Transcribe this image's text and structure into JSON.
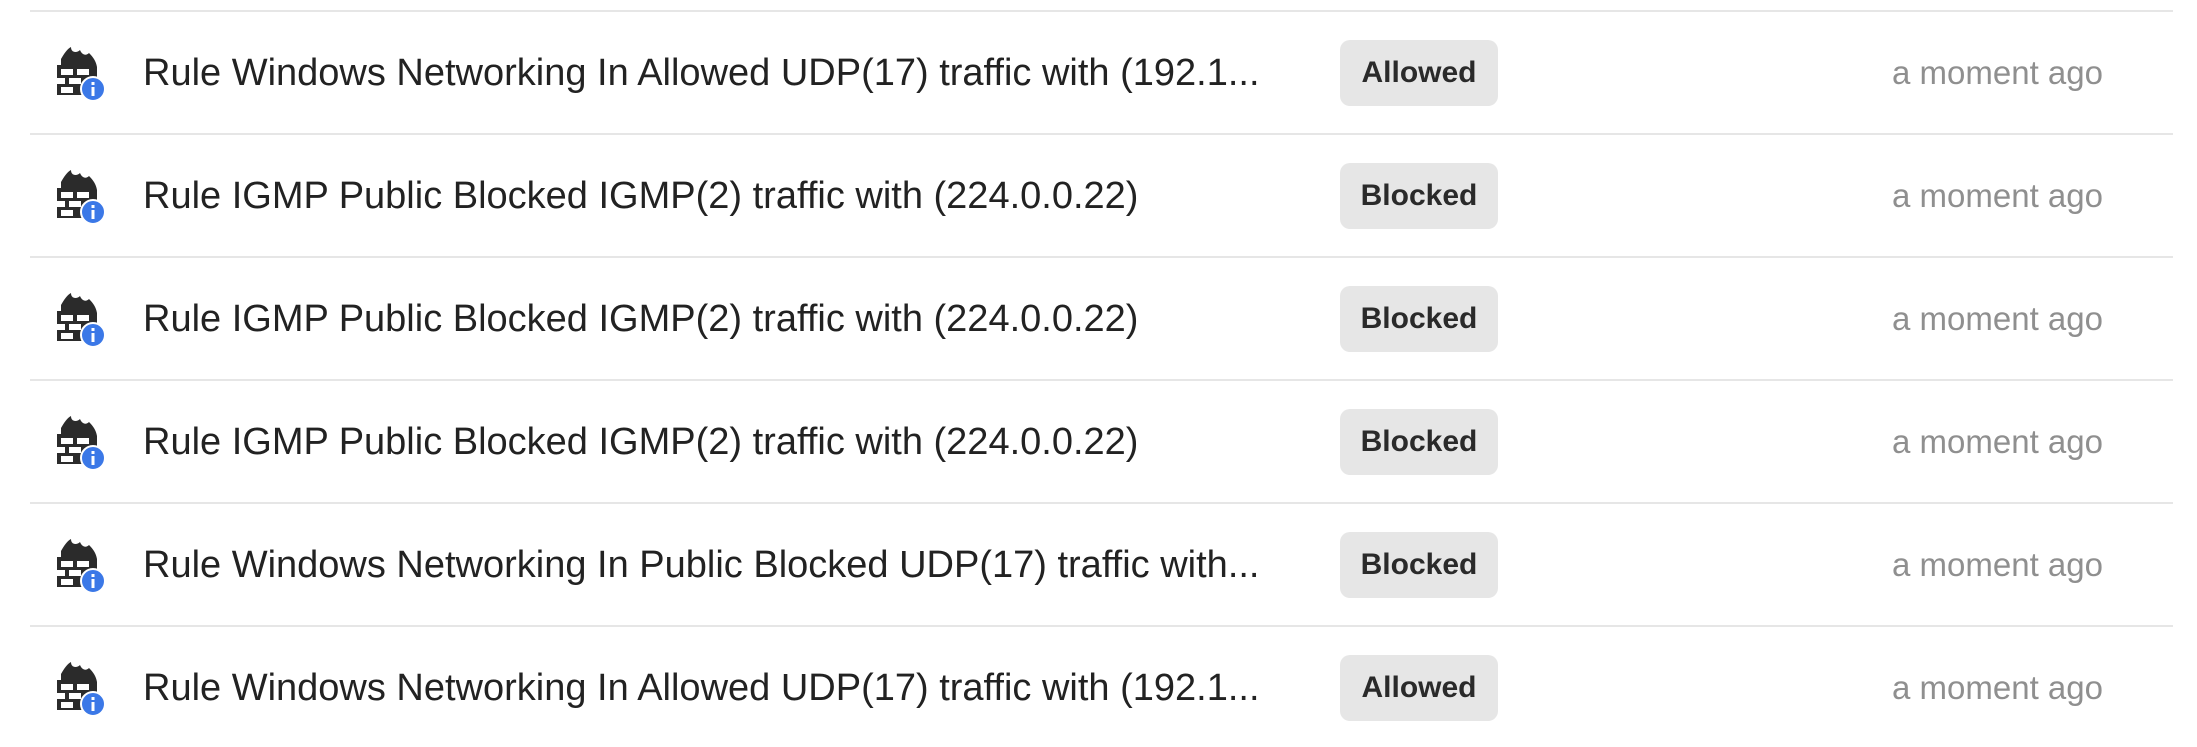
{
  "icon_name": "firewall-info-icon",
  "colors": {
    "icon_dark": "#2b2b2b",
    "info_badge": "#3b78e7",
    "badge_bg": "#e6e6e6",
    "divider": "#e6e6e6",
    "timestamp": "#8f8f8f"
  },
  "events": [
    {
      "title": "Rule Windows Networking In Allowed UDP(17) traffic with (192.1...",
      "status": "Allowed",
      "time": "a moment ago"
    },
    {
      "title": "Rule IGMP Public Blocked IGMP(2) traffic with (224.0.0.22)",
      "status": "Blocked",
      "time": "a moment ago"
    },
    {
      "title": "Rule IGMP Public Blocked IGMP(2) traffic with (224.0.0.22)",
      "status": "Blocked",
      "time": "a moment ago"
    },
    {
      "title": "Rule IGMP Public Blocked IGMP(2) traffic with (224.0.0.22)",
      "status": "Blocked",
      "time": "a moment ago"
    },
    {
      "title": "Rule Windows Networking In Public Blocked UDP(17) traffic with...",
      "status": "Blocked",
      "time": "a moment ago"
    },
    {
      "title": "Rule Windows Networking In Allowed UDP(17) traffic with (192.1...",
      "status": "Allowed",
      "time": "a moment ago"
    }
  ]
}
